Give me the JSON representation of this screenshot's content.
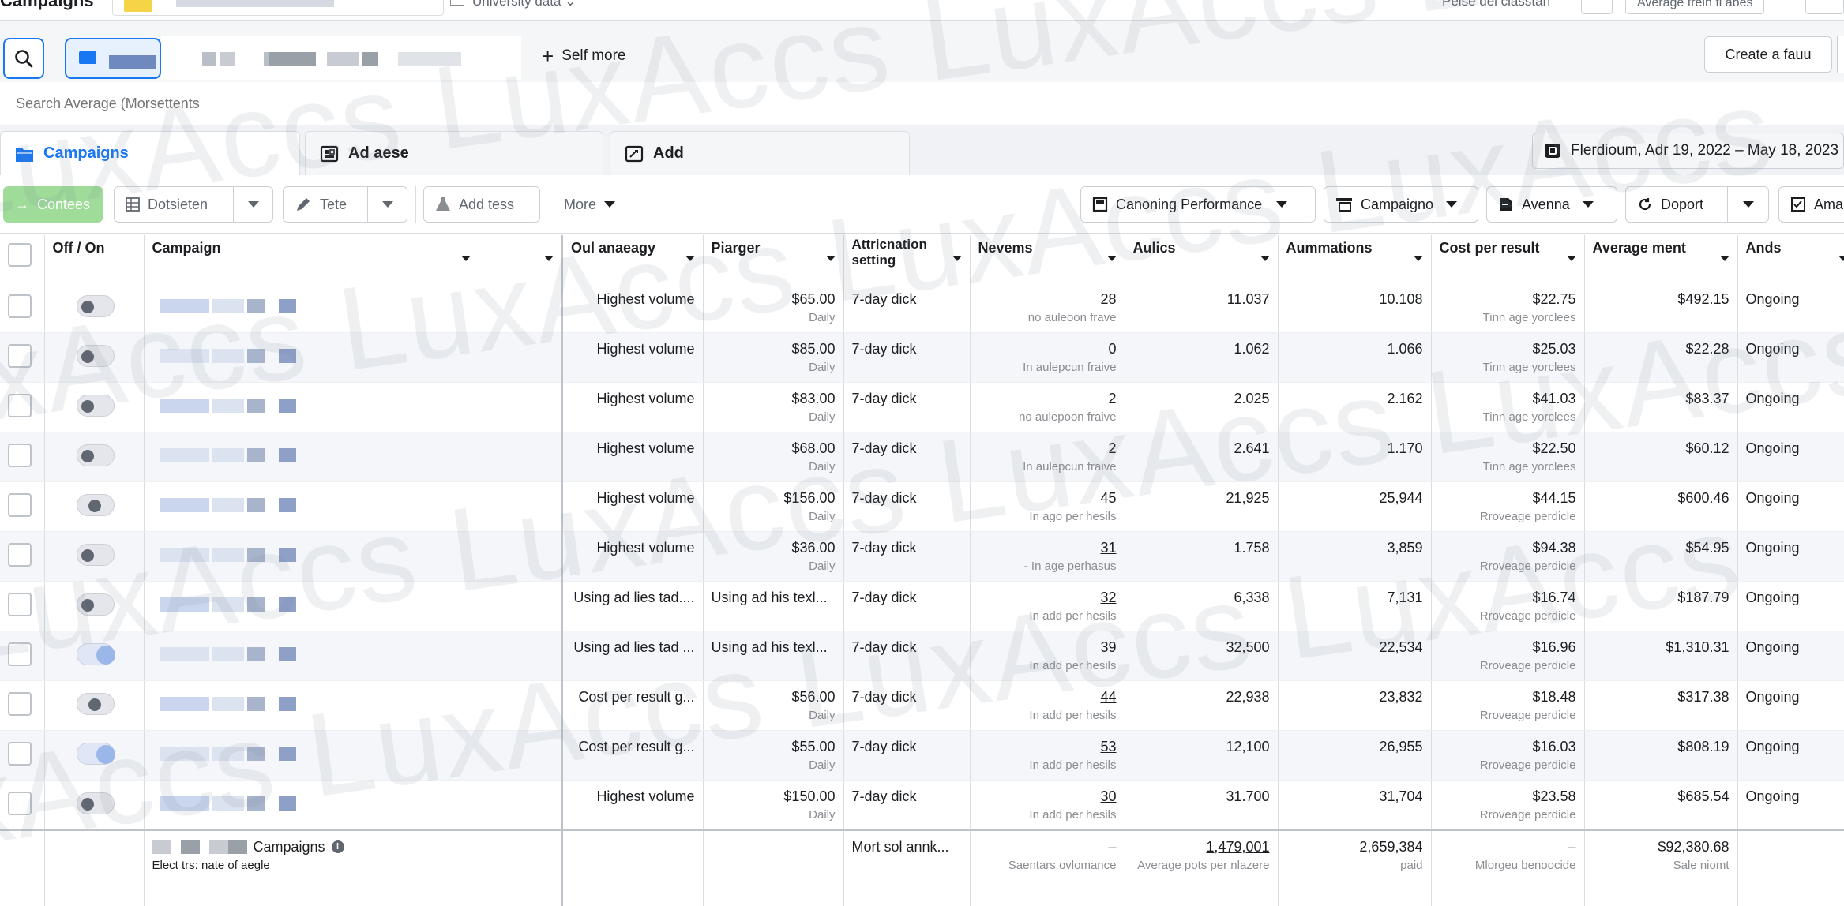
{
  "top": {
    "title": "Campaigns",
    "dropdown_label": "University data",
    "right_label": "Pelse del classtan",
    "right_btn": "Average frein fl abes"
  },
  "search": {
    "placeholder": "Search Average (Morsettents"
  },
  "row2": {
    "show_more": "Self more",
    "create_label": "Create a fauu"
  },
  "tabs": [
    {
      "label": "Campaigns",
      "icon": "folder-icon",
      "active": true
    },
    {
      "label": "Ad aese",
      "icon": "ad-set-icon",
      "active": false
    },
    {
      "label": "Add",
      "icon": "ad-icon",
      "active": false
    }
  ],
  "date_range": "Flerdioum, Adr 19, 2022 – May 18, 2023",
  "toolbar": {
    "create": "Contees",
    "duplicate": "Dotsieten",
    "edit": "Tete",
    "add_test": "Add tess",
    "more": "More",
    "performance": "Canoning Performance",
    "campaigns_filter": "Campaigno",
    "avenna": "Avenna",
    "export": "Doport",
    "ama": "Ama"
  },
  "columns": {
    "off_on": "Off / On",
    "campaign": "Campaign",
    "blank": "",
    "bid_strategy": "Oul anaeagy",
    "budget": "Piarger",
    "attribution": "Attricnation setting",
    "results": "Nevems",
    "reach": "Aulics",
    "impressions": "Aummations",
    "cost_per_result": "Cost per result",
    "amount_spent": "Average ment",
    "ends": "Ands"
  },
  "rows": [
    {
      "toggle": "off",
      "bid": "Highest volume",
      "bid2": "",
      "budget": "$65.00",
      "budget_sub": "Daily",
      "attr": "7-day dick",
      "results": "28",
      "results_sub": "no auleoon frave",
      "reach": "11.037",
      "impr": "10.108",
      "cpr": "$22.75",
      "cpr_sub": "Tinn age yorclees",
      "spent": "$492.15",
      "ends": "Ongoing"
    },
    {
      "toggle": "off",
      "bid": "Highest volume",
      "bid2": "",
      "budget": "$85.00",
      "budget_sub": "Daily",
      "attr": "7-day dick",
      "results": "0",
      "results_sub": "In aulepcun fraive",
      "reach": "1.062",
      "impr": "1.066",
      "cpr": "$25.03",
      "cpr_sub": "Tinn age yorclees",
      "spent": "$22.28",
      "ends": "Ongoing"
    },
    {
      "toggle": "off",
      "bid": "Highest volume",
      "bid2": "",
      "budget": "$83.00",
      "budget_sub": "Daily",
      "attr": "7-day dick",
      "results": "2",
      "results_sub": "no aulepoon fraive",
      "reach": "2.025",
      "impr": "2.162",
      "cpr": "$41.03",
      "cpr_sub": "Tinn age yorclees",
      "spent": "$83.37",
      "ends": "Ongoing"
    },
    {
      "toggle": "off",
      "bid": "Highest volume",
      "bid2": "",
      "budget": "$68.00",
      "budget_sub": "Daily",
      "attr": "7-day dick",
      "results": "2",
      "results_sub": "In aulepcun fraive",
      "reach": "2.641",
      "impr": "1.170",
      "cpr": "$22.50",
      "cpr_sub": "Tinn age yorclees",
      "spent": "$60.12",
      "ends": "Ongoing"
    },
    {
      "toggle": "half",
      "bid": "Highest volume",
      "bid2": "",
      "budget": "$156.00",
      "budget_sub": "Daily",
      "attr": "7-day dick",
      "results": "45",
      "results_sub": "In ago per hesils",
      "reach": "21,925",
      "impr": "25,944",
      "cpr": "$44.15",
      "cpr_sub": "Rroveage perdicle",
      "spent": "$600.46",
      "ends": "Ongoing"
    },
    {
      "toggle": "off",
      "bid": "Highest volume",
      "bid2": "",
      "budget": "$36.00",
      "budget_sub": "Daily",
      "attr": "7-day dick",
      "results": "31",
      "results_sub": "- In age perhasus",
      "reach": "1.758",
      "impr": "3,859",
      "cpr": "$94.38",
      "cpr_sub": "Rroveage perdicle",
      "spent": "$54.95",
      "ends": "Ongoing"
    },
    {
      "toggle": "off",
      "bid": "Using ad lies tad....",
      "bid2": "Using ad his texl...",
      "budget": "",
      "budget_sub": "",
      "attr": "7-day dick",
      "results": "32",
      "results_sub": "In add per hesils",
      "reach": "6,338",
      "impr": "7,131",
      "cpr": "$16.74",
      "cpr_sub": "Rroveage perdicle",
      "spent": "$187.79",
      "ends": "Ongoing"
    },
    {
      "toggle": "on",
      "bid": "Using ad lies tad ...",
      "bid2": "Using ad his texl...",
      "budget": "",
      "budget_sub": "",
      "attr": "7-day dick",
      "results": "39",
      "results_sub": "In add per hesils",
      "reach": "32,500",
      "impr": "22,534",
      "cpr": "$16.96",
      "cpr_sub": "Rroveage perdicle",
      "spent": "$1,310.31",
      "ends": "Ongoing"
    },
    {
      "toggle": "half",
      "bid": "Cost per result g...",
      "bid2": "",
      "budget": "$56.00",
      "budget_sub": "Daily",
      "attr": "7-day dick",
      "results": "44",
      "results_sub": "In add per hesils",
      "reach": "22,938",
      "impr": "23,832",
      "cpr": "$18.48",
      "cpr_sub": "Rroveage perdicle",
      "spent": "$317.38",
      "ends": "Ongoing"
    },
    {
      "toggle": "on",
      "bid": "Cost per result g...",
      "bid2": "",
      "budget": "$55.00",
      "budget_sub": "Daily",
      "attr": "7-day dick",
      "results": "53",
      "results_sub": "In add per hesils",
      "reach": "12,100",
      "impr": "26,955",
      "cpr": "$16.03",
      "cpr_sub": "Rroveage perdicle",
      "spent": "$808.19",
      "ends": "Ongoing"
    },
    {
      "toggle": "off",
      "bid": "Highest volume",
      "bid2": "",
      "budget": "$150.00",
      "budget_sub": "Daily",
      "attr": "7-day dick",
      "results": "30",
      "results_sub": "In add per hesils",
      "reach": "31.700",
      "impr": "31,704",
      "cpr": "$23.58",
      "cpr_sub": "Rroveage perdicle",
      "spent": "$685.54",
      "ends": "Ongoing"
    }
  ],
  "footer": {
    "campaigns_label": "Campaigns",
    "campaigns_sub": "Elect trs: nate of aegle",
    "attr": "Mort sol annk...",
    "results": "–",
    "results_sub": "Saentars ovlomance",
    "reach": "1,479,001",
    "reach_sub": "Average pots per nlazere",
    "impr": "2,659,384",
    "impr_sub": "paid",
    "cpr": "–",
    "cpr_sub": "Mlorgeu benoocide",
    "spent": "$92,380.68",
    "spent_sub": "Sale niomt"
  },
  "watermark": "LuxAccs LuxAccs LuxAccs LuxAccs",
  "colors": {
    "accent": "#1877f2",
    "green": "#9fdc9a",
    "row_shade": "#f4f6fa"
  }
}
